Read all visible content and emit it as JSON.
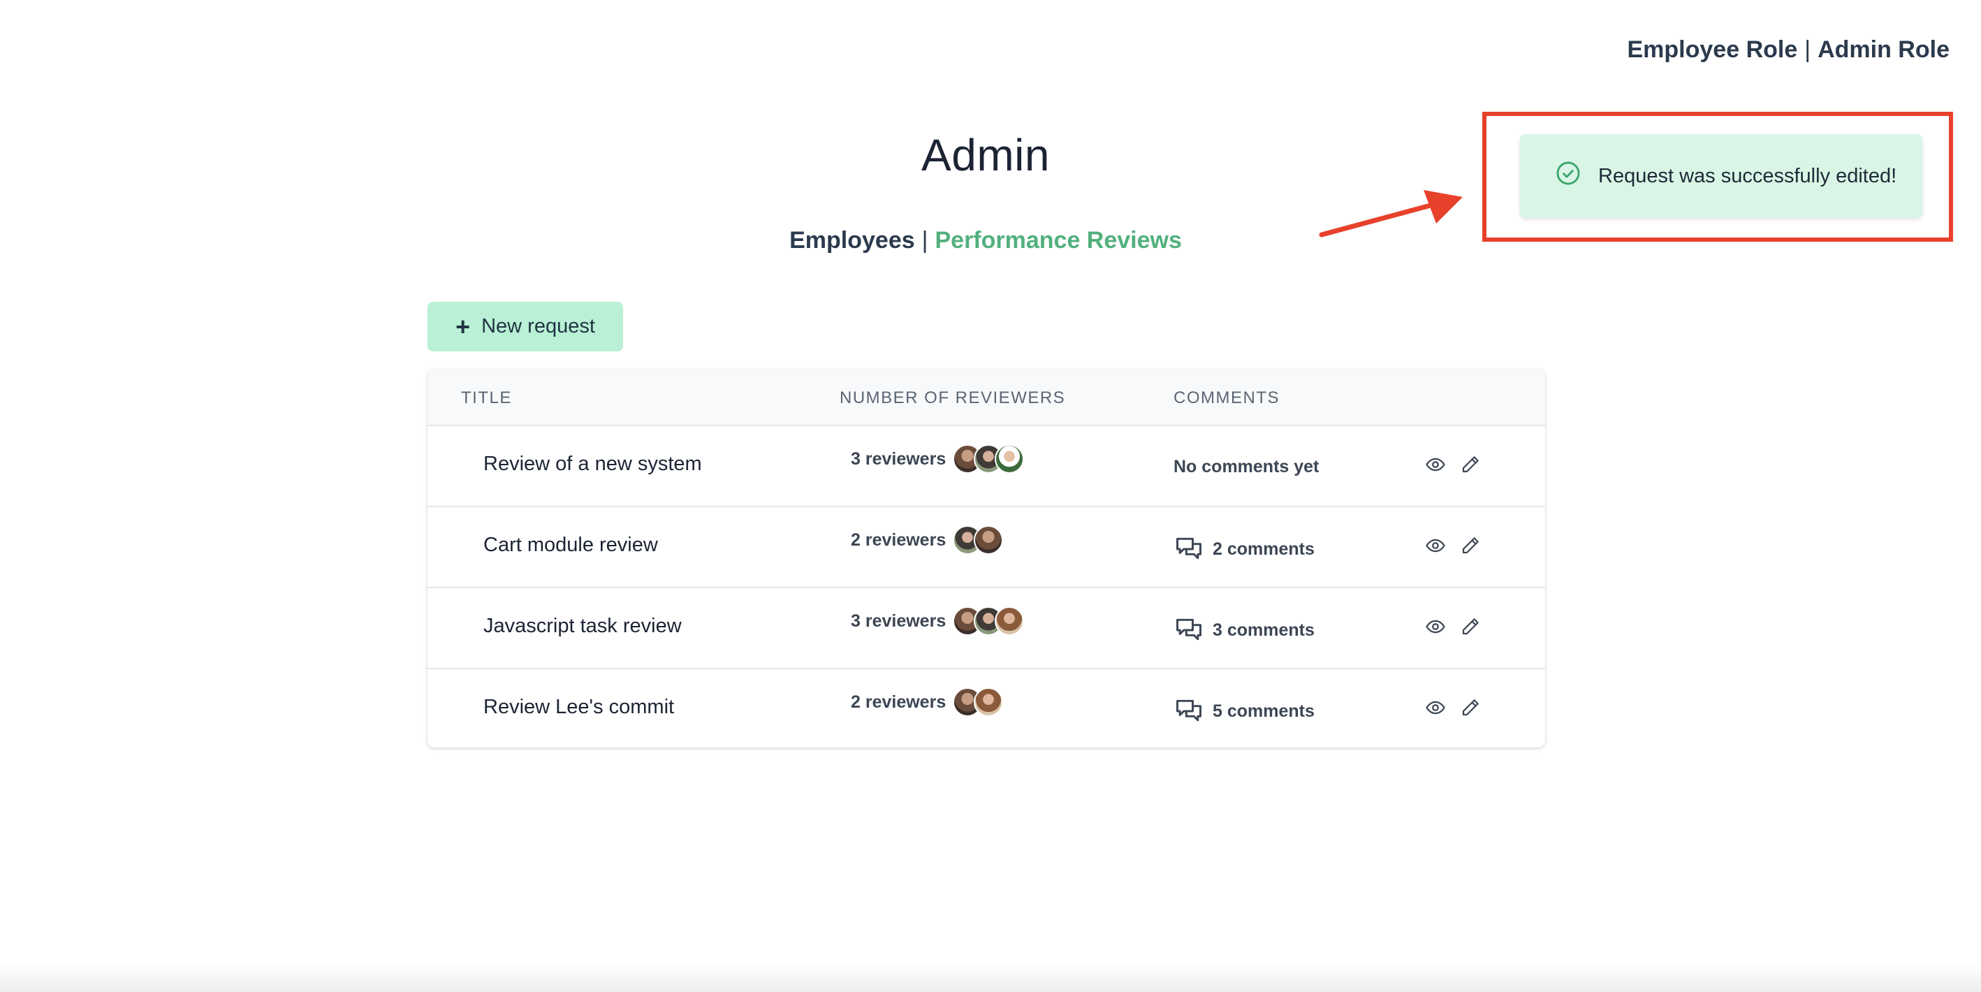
{
  "roles": {
    "employee": "Employee Role",
    "separator": "|",
    "admin": "Admin Role"
  },
  "page": {
    "title": "Admin"
  },
  "nav": {
    "employees": "Employees",
    "separator": "|",
    "reviews": "Performance Reviews",
    "active": "Performance Reviews"
  },
  "toolbar": {
    "new_request_icon": "plus-icon",
    "new_request_label": "New request"
  },
  "table": {
    "headers": {
      "title": "TITLE",
      "reviewers": "NUMBER OF REVIEWERS",
      "comments": "COMMENTS"
    },
    "rows": [
      {
        "title": "Review of a new system",
        "reviewers": "3 reviewers",
        "comments": "No comments yet"
      },
      {
        "title": "Cart module review",
        "reviewers": "2 reviewers",
        "comments": "2 comments"
      },
      {
        "title": "Javascript task review",
        "reviewers": "3 reviewers",
        "comments": "3 comments"
      },
      {
        "title": "Review Lee's commit",
        "reviewers": "2 reviewers",
        "comments": "5 comments"
      }
    ]
  },
  "toast": {
    "icon": "check-circle-icon",
    "message": "Request was successfully edited!"
  },
  "colors": {
    "accent_green": "#52b07d",
    "button_bg": "#b9f0d6",
    "toast_bg": "#d9f5e6",
    "highlight_red": "#e8412b"
  }
}
